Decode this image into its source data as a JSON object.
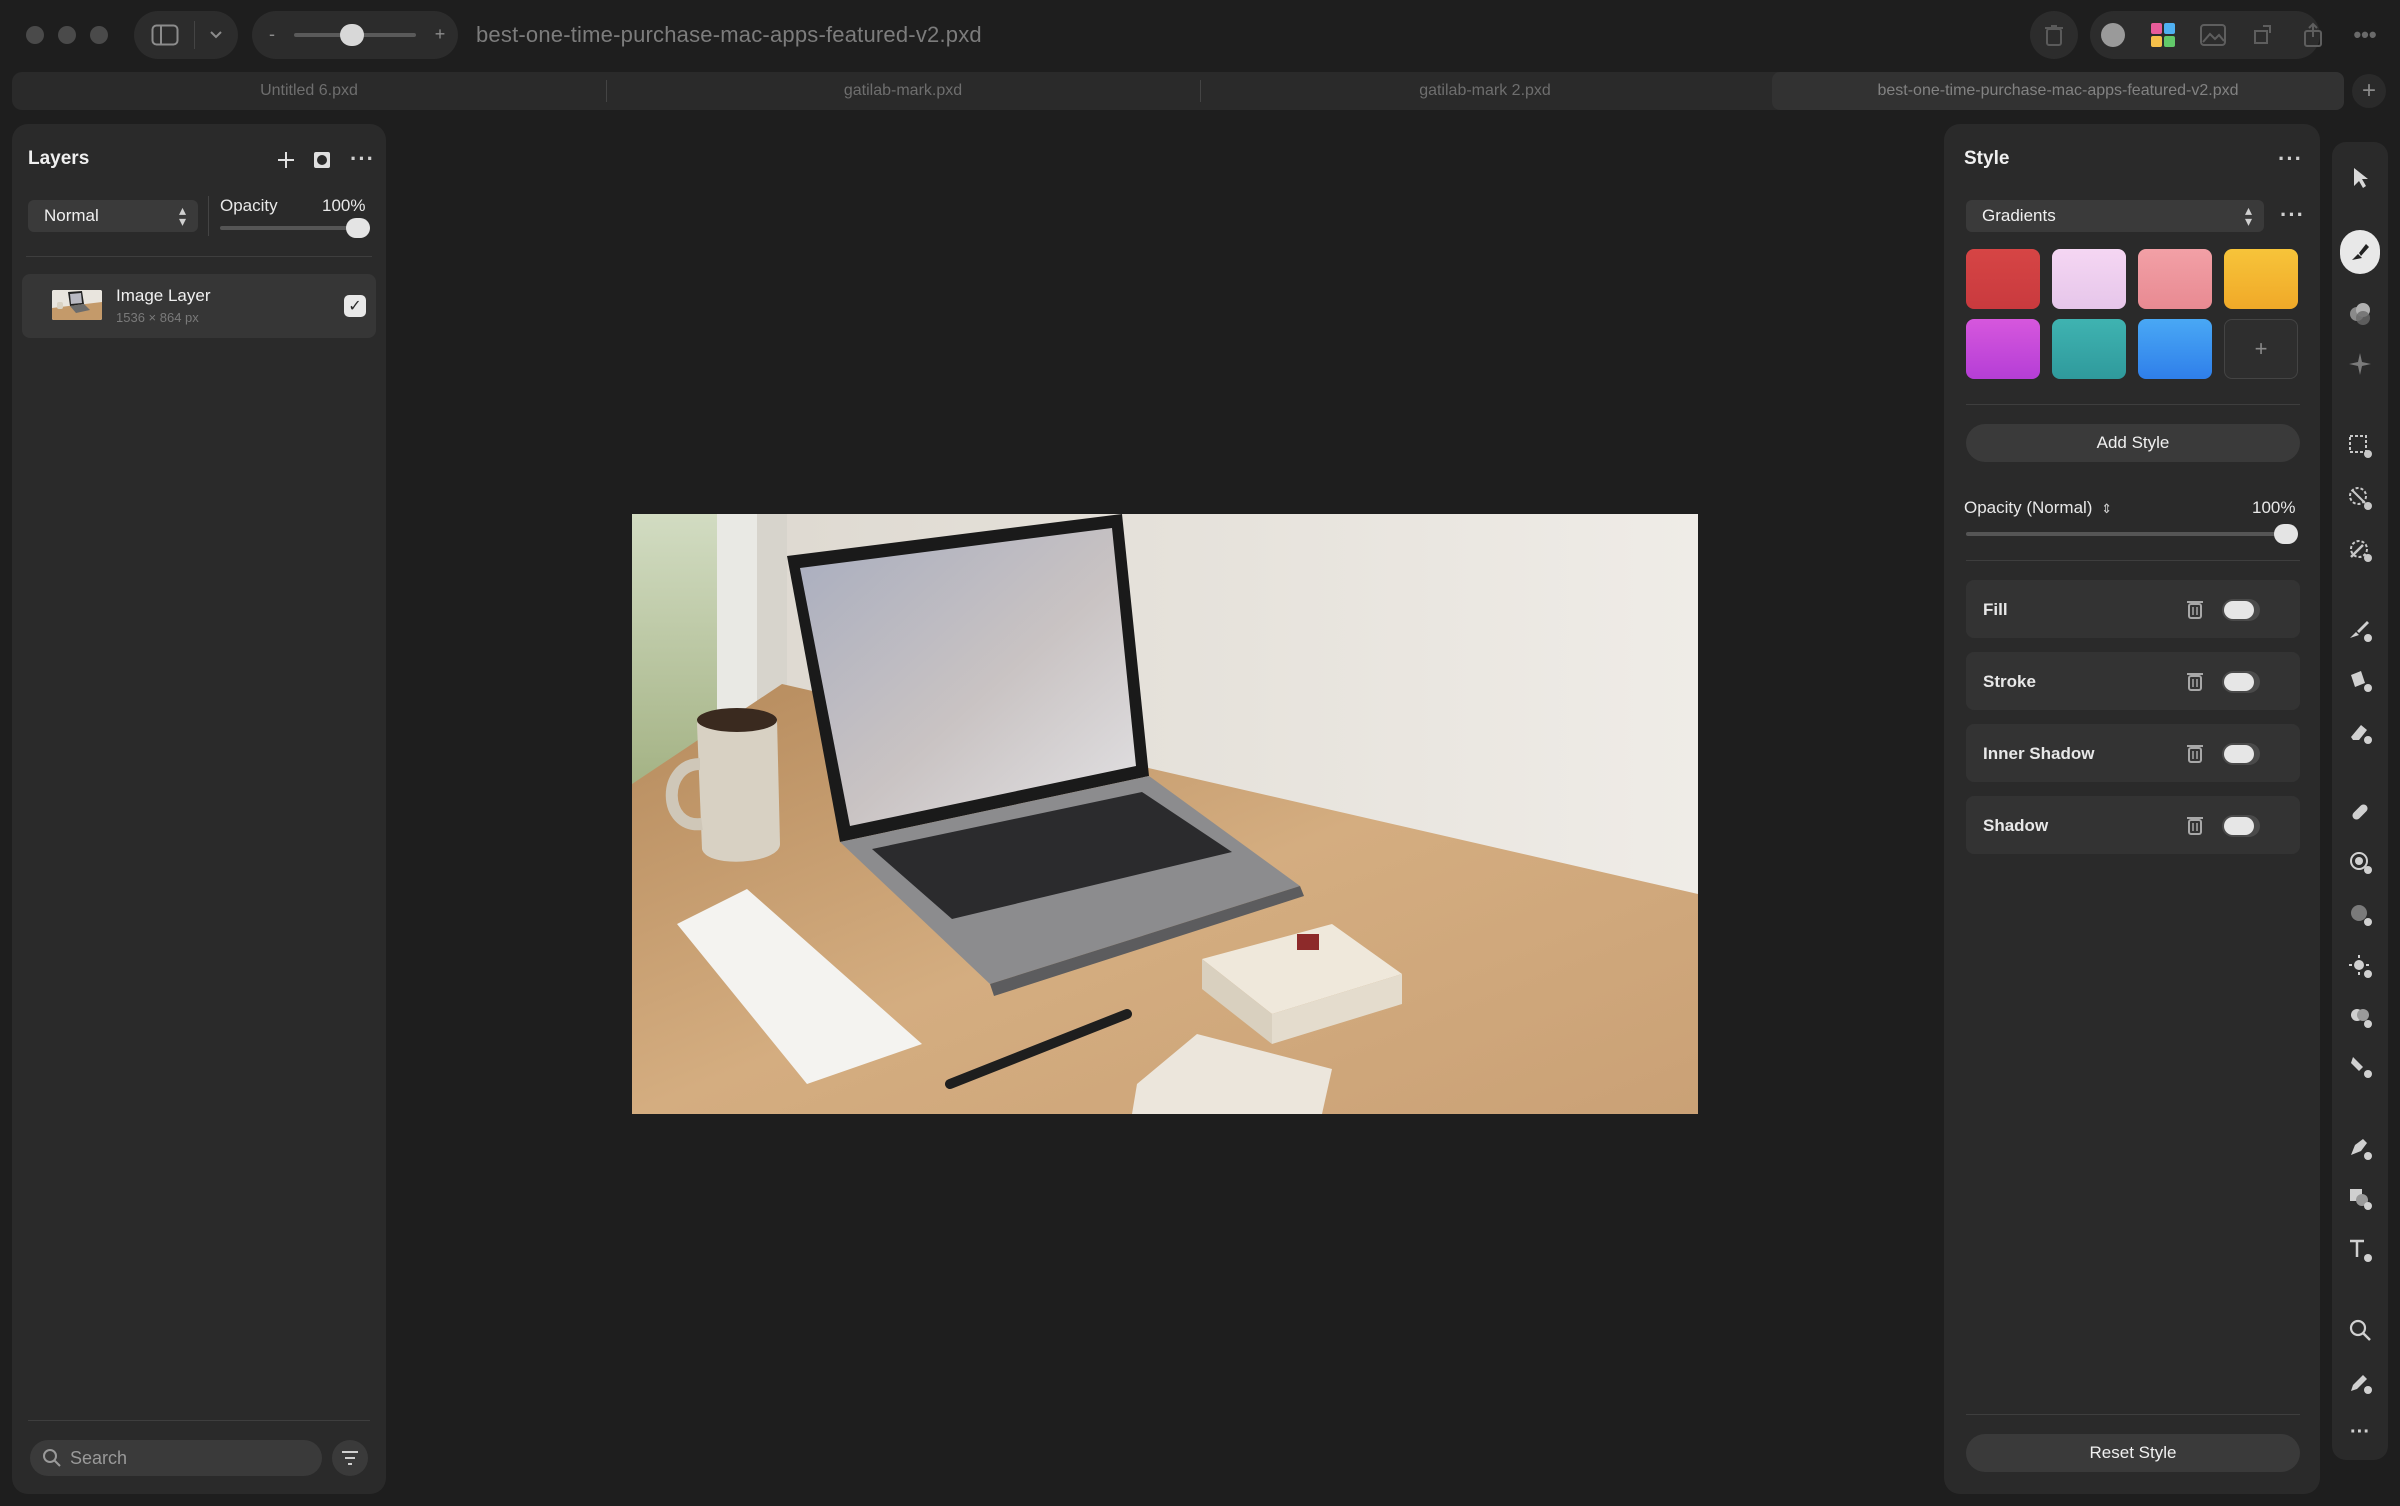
{
  "window": {
    "document_title": "best-one-time-purchase-mac-apps-featured-v2.pxd",
    "zoom_minus": "-",
    "zoom_plus": "+"
  },
  "tabs": [
    {
      "label": "Untitled 6.pxd",
      "active": false
    },
    {
      "label": "gatilab-mark.pxd",
      "active": false
    },
    {
      "label": "gatilab-mark 2.pxd",
      "active": false
    },
    {
      "label": "best-one-time-purchase-mac-apps-featured-v2.pxd",
      "active": true
    }
  ],
  "tab_add": "+",
  "layers_panel": {
    "title": "Layers",
    "blend_mode": "Normal",
    "opacity_label": "Opacity",
    "opacity_value": "100%",
    "opacity_level": 1.0,
    "layer": {
      "name": "Image Layer",
      "dimensions": "1536 × 864 px",
      "visible": true
    },
    "search_placeholder": "Search"
  },
  "style_panel": {
    "title": "Style",
    "preset_category": "Gradients",
    "swatch_colors": [
      [
        "#d64545",
        "#c93a3e"
      ],
      [
        "#f5d6f3",
        "#e6c6ea"
      ],
      [
        "#f2a0a6",
        "#e88a92"
      ],
      [
        "#f7c43a",
        "#f0a928"
      ],
      [
        "#d657dd",
        "#b53ed6"
      ],
      [
        "#3fb3b1",
        "#2f9a9c"
      ],
      [
        "#49a8f5",
        "#2f7fea"
      ]
    ],
    "add_swatch": "+",
    "add_style_label": "Add Style",
    "opacity_label": "Opacity (Normal)",
    "opacity_value": "100%",
    "opacity_level": 1.0,
    "effects": [
      {
        "label": "Fill",
        "enabled": true
      },
      {
        "label": "Stroke",
        "enabled": true
      },
      {
        "label": "Inner Shadow",
        "enabled": true
      },
      {
        "label": "Shadow",
        "enabled": true
      }
    ],
    "reset_label": "Reset Style"
  },
  "tools": [
    "arrow-select-icon",
    "style-brush-icon",
    "color-adjust-icon",
    "sparkle-effects-icon",
    "rect-select-icon",
    "quick-select-icon",
    "magic-select-icon",
    "paint-brush-icon",
    "paint-bucket-icon",
    "eraser-icon",
    "bandage-repair-icon",
    "clone-icon",
    "blur-icon",
    "light-icon",
    "dodge-burn-icon",
    "smudge-icon",
    "pen-icon",
    "shape-icon",
    "text-icon",
    "zoom-icon",
    "eyedropper-icon",
    "more-icon"
  ]
}
